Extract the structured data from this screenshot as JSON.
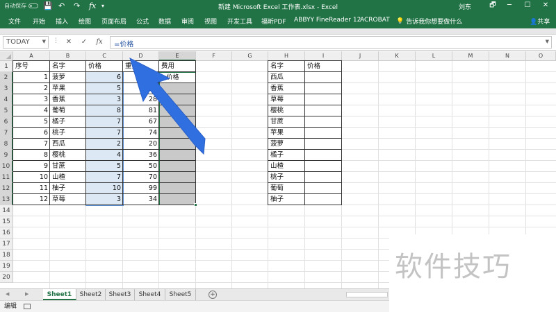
{
  "titlebar": {
    "autosave": "自动保存",
    "qa_save": "💾",
    "qa_undo": "↶",
    "qa_redo": "↷",
    "title": "新建 Microsoft Excel 工作表.xlsx  -  Excel",
    "user": "刘东",
    "restore": "🗗",
    "minimize": "─",
    "maximize": "☐",
    "close": "✕"
  },
  "ribbon": {
    "tabs": [
      "文件",
      "开始",
      "插入",
      "绘图",
      "页面布局",
      "公式",
      "数据",
      "审阅",
      "视图",
      "开发工具",
      "福昕PDF",
      "ABBYY FineReader 12",
      "ACROBAT"
    ],
    "tell_me": "告诉我你想要做什么",
    "share": "共享"
  },
  "formula_bar": {
    "name_box": "TODAY",
    "cancel": "✕",
    "enter": "✓",
    "fx": "fx",
    "formula": "=价格"
  },
  "grid": {
    "columns": [
      "A",
      "B",
      "C",
      "D",
      "E",
      "F",
      "G",
      "H",
      "I",
      "J",
      "K",
      "L",
      "M",
      "N",
      "O"
    ],
    "rows": [
      "1",
      "2",
      "3",
      "4",
      "5",
      "6",
      "7",
      "8",
      "9",
      "10",
      "11",
      "12",
      "13",
      "14",
      "15",
      "16",
      "17",
      "18",
      "19",
      "20"
    ],
    "table1": {
      "headers": [
        "序号",
        "名字",
        "价格",
        "重量",
        "费用"
      ],
      "rows": [
        [
          "1",
          "菠萝",
          "6",
          "",
          "=价格"
        ],
        [
          "2",
          "苹果",
          "5",
          "9",
          ""
        ],
        [
          "3",
          "香蕉",
          "3",
          "28",
          ""
        ],
        [
          "4",
          "葡萄",
          "8",
          "81",
          ""
        ],
        [
          "5",
          "橘子",
          "7",
          "67",
          ""
        ],
        [
          "6",
          "桃子",
          "7",
          "74",
          ""
        ],
        [
          "7",
          "西瓜",
          "2",
          "20",
          ""
        ],
        [
          "8",
          "樱桃",
          "4",
          "36",
          ""
        ],
        [
          "9",
          "甘蔗",
          "5",
          "50",
          ""
        ],
        [
          "10",
          "山楂",
          "7",
          "70",
          ""
        ],
        [
          "11",
          "柚子",
          "10",
          "99",
          ""
        ],
        [
          "12",
          "草莓",
          "3",
          "34",
          ""
        ]
      ]
    },
    "table2": {
      "headers": [
        "名字",
        "价格"
      ],
      "names": [
        "西瓜",
        "香蕉",
        "草莓",
        "樱桃",
        "甘蔗",
        "苹果",
        "菠萝",
        "橘子",
        "山楂",
        "桃子",
        "葡萄",
        "柚子"
      ]
    }
  },
  "sheets": {
    "tabs": [
      "Sheet1",
      "Sheet2",
      "Sheet3",
      "Sheet4",
      "Sheet5"
    ],
    "active": "Sheet1",
    "add": "+"
  },
  "status": {
    "mode": "编辑"
  },
  "watermark": "软件技巧",
  "colors": {
    "excel_green": "#217346",
    "highlight_blue": "#dde8f5",
    "highlight_gray": "#c9c9c9",
    "arrow_blue": "#2f6fe0"
  }
}
